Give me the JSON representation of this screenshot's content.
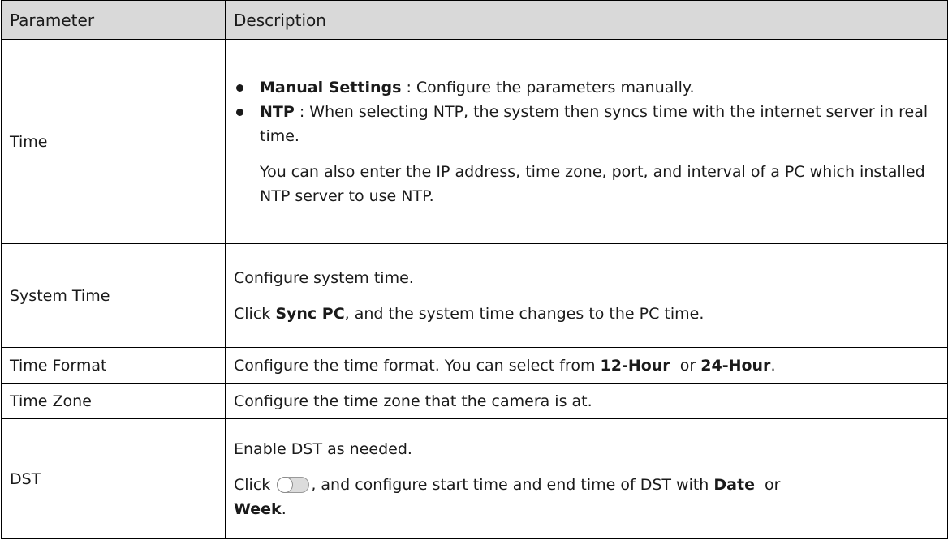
{
  "header": {
    "param": "Parameter",
    "desc": "Description"
  },
  "rows": {
    "time": {
      "param": "Time",
      "b1_bold": "Manual Settings",
      "b1_text": " : Configure the parameters manually.",
      "b2_bold": "NTP",
      "b2_text": " : When selecting NTP, the system then syncs time with the internet server in real time.",
      "note": "You can also enter the IP address, time zone, port, and interval of a PC which installed NTP server to use NTP."
    },
    "system_time": {
      "param": "System Time",
      "line1": "Configure system time.",
      "line2_pre": "Click ",
      "line2_bold": "Sync PC",
      "line2_post": ", and the system time changes to the PC time."
    },
    "time_format": {
      "param": "Time Format",
      "pre": "Configure the time format. You can select from ",
      "opt1": "12-Hour",
      "mid": "  or ",
      "opt2": "24-Hour",
      "post": "."
    },
    "time_zone": {
      "param": "Time Zone",
      "text": "Configure the time zone that the camera is at."
    },
    "dst": {
      "param": "DST",
      "line1": "Enable DST as needed.",
      "line2_pre": "Click ",
      "line2_mid": ", and configure start time and end time of DST with ",
      "opt1": "Date",
      "or": "  or ",
      "opt2": "Week",
      "post": "."
    }
  },
  "icons": {
    "toggle": "toggle-switch-icon"
  }
}
